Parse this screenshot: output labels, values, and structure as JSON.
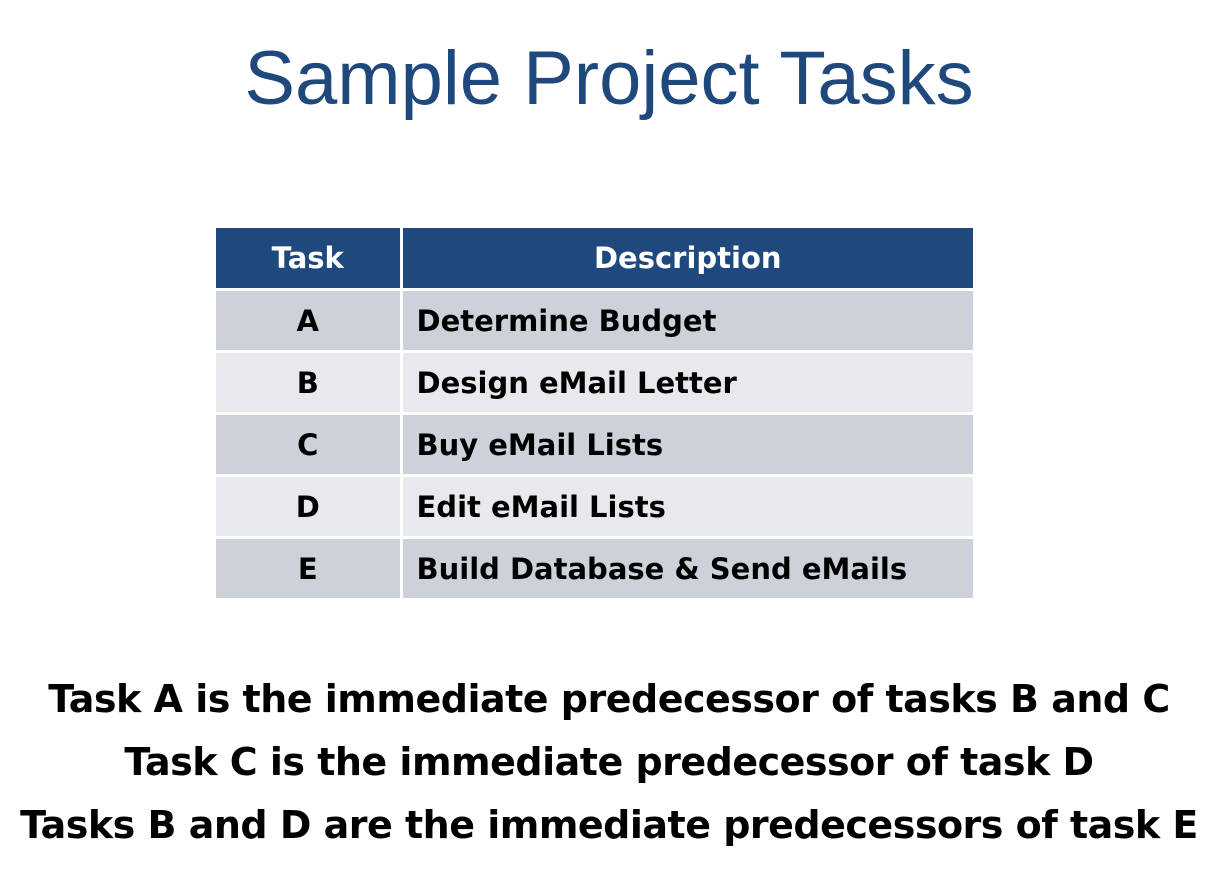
{
  "slide": {
    "title": "Sample Project Tasks"
  },
  "table": {
    "headers": [
      "Task",
      "Description"
    ],
    "rows": [
      {
        "task": "A",
        "description": "Determine Budget"
      },
      {
        "task": "B",
        "description": "Design eMail Letter"
      },
      {
        "task": "C",
        "description": "Buy eMail Lists"
      },
      {
        "task": "D",
        "description": "Edit eMail Lists"
      },
      {
        "task": "E",
        "description": "Build Database & Send eMails"
      }
    ]
  },
  "notes": [
    "Task A is the immediate predecessor of tasks B and C",
    "Task C is the immediate predecessor of task D",
    "Tasks B and D are the immediate predecessors of task E"
  ],
  "colors": {
    "title": "#1f497d",
    "header_bg": "#1f497d",
    "row_dark": "#cdd1d9",
    "row_light": "#e8e9ec"
  }
}
